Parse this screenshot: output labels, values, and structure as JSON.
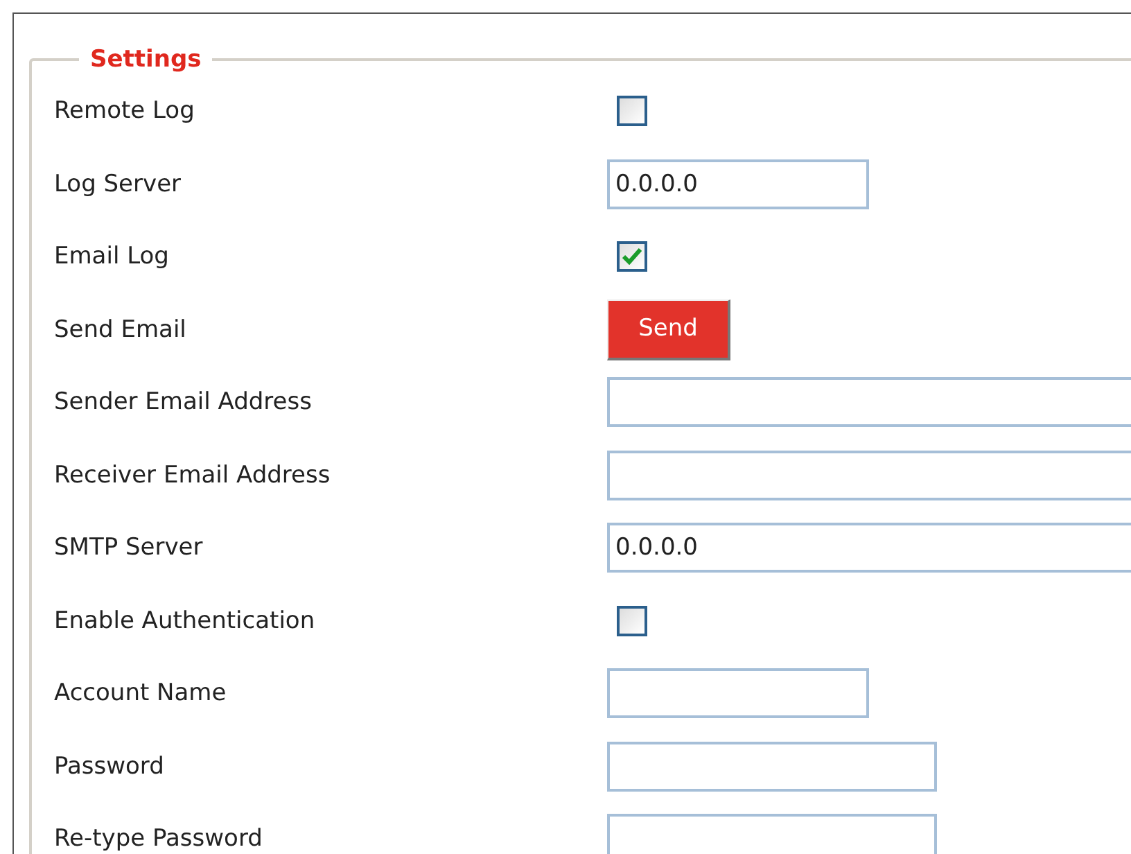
{
  "settings": {
    "legend": "Settings",
    "rows": [
      {
        "label": "Remote Log",
        "kind": "checkbox",
        "checked": false
      },
      {
        "label": "Log Server",
        "kind": "short_field",
        "value": "0.0.0.0"
      },
      {
        "label": "Email Log",
        "kind": "checkbox",
        "checked": true
      },
      {
        "label": "Send Email",
        "kind": "button",
        "button": "Send"
      },
      {
        "label": "Sender Email Address",
        "kind": "wide_field"
      },
      {
        "label": "Receiver Email Address",
        "kind": "wide_field"
      },
      {
        "label": "SMTP Server",
        "kind": "wide_field",
        "value": "0.0.0.0"
      },
      {
        "label": "Enable Authentication",
        "kind": "checkbox",
        "checked": false
      },
      {
        "label": "Account Name",
        "kind": "short_field"
      },
      {
        "label": "Password",
        "kind": "password_field"
      },
      {
        "label": "Re-type Password",
        "kind": "password_field"
      }
    ]
  }
}
